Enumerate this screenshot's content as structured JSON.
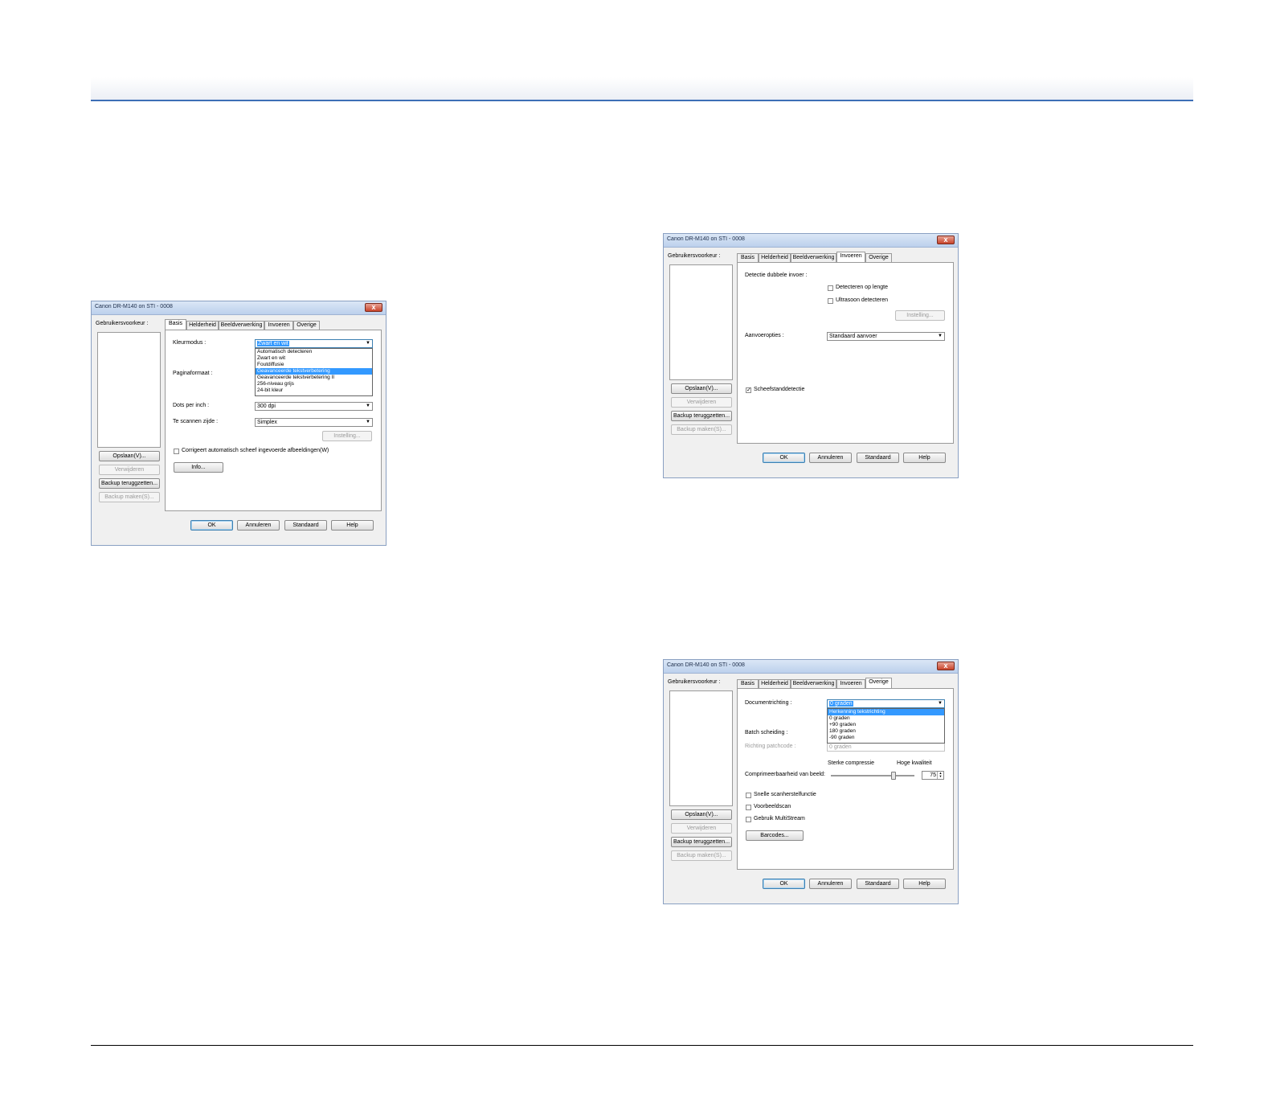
{
  "dialog_basis": {
    "title": "Canon DR-M140 on STI - 0008",
    "close": "x",
    "user_prefs_label": "Gebruikersvoorkeur :",
    "tabs": [
      "Basis",
      "Helderheid",
      "Beeldverwerking",
      "Invoeren",
      "Overige"
    ],
    "active_tab": "Basis",
    "color_mode_label": "Kleurmodus :",
    "color_mode_value": "Zwart en wit",
    "color_mode_options": [
      "Automatisch detecteren",
      "Zwart en wit",
      "Foutdiffusie",
      "Geavanceerde tekstverbetering",
      "Geavanceerde tekstverbetering II",
      "256-niveau grijs",
      "24-bit kleur"
    ],
    "color_mode_highlighted": "Geavanceerde tekstverbetering",
    "page_size_label": "Paginaformaat :",
    "dpi_label": "Dots per inch :",
    "dpi_value": "300 dpi",
    "side_label": "Te scannen zijde :",
    "side_value": "Simplex",
    "settings_button": "Instelling...",
    "deskew_label": "Corrigeert automatisch scheef ingevoerde afbeeldingen(W)",
    "info_button": "Info...",
    "save_button": "Opslaan(V)...",
    "delete_button": "Verwijderen",
    "restore_button": "Backup teruggzetten...",
    "backup_button": "Backup maken(S)...",
    "ok": "OK",
    "cancel": "Annuleren",
    "default": "Standaard",
    "help": "Help"
  },
  "dialog_invoeren": {
    "title": "Canon DR-M140 on STI - 0008",
    "close": "x",
    "user_prefs_label": "Gebruikersvoorkeur :",
    "tabs": [
      "Basis",
      "Helderheid",
      "Beeldverwerking",
      "Invoeren",
      "Overige"
    ],
    "active_tab": "Invoeren",
    "double_feed_label": "Detectie dubbele invoer :",
    "detect_length_label": "Detecteren op lengte",
    "ultrasonic_label": "Ultrasoon detecteren",
    "settings_button": "Instelling...",
    "feed_options_label": "Aanvoeropties :",
    "feed_options_value": "Standaard aanvoer",
    "skew_detect_label": "Scheefstanddetectie",
    "skew_detect_checked": true,
    "save_button": "Opslaan(V)...",
    "delete_button": "Verwijderen",
    "restore_button": "Backup teruggzetten...",
    "backup_button": "Backup maken(S)...",
    "ok": "OK",
    "cancel": "Annuleren",
    "default": "Standaard",
    "help": "Help"
  },
  "dialog_overige": {
    "title": "Canon DR-M140 on STI - 0008",
    "close": "x",
    "user_prefs_label": "Gebruikersvoorkeur :",
    "tabs": [
      "Basis",
      "Helderheid",
      "Beeldverwerking",
      "Invoeren",
      "Overige"
    ],
    "active_tab": "Overige",
    "doc_orientation_label": "Documentrichting :",
    "doc_orientation_value": "0 graden",
    "doc_orientation_options": [
      "Herkenning tekstrichting",
      "0 graden",
      "+90 graden",
      "180 graden",
      "-90 graden"
    ],
    "doc_orientation_highlighted": "Herkenning tekstrichting",
    "batch_label": "Batch scheiding :",
    "patch_label": "Richting patchcode :",
    "patch_value": "0 graden",
    "compress_low_label": "Sterke compressie",
    "compress_high_label": "Hoge kwaliteit",
    "compress_label": "Comprimeerbaarheid van beeld:",
    "compress_value": "75",
    "compress_level": 0.75,
    "quick_recovery_label": "Snelle scanherstelfunctie",
    "prescan_label": "Voorbeeldscan",
    "multistream_label": "Gebruik MultiStream",
    "barcodes_button": "Barcodes...",
    "save_button": "Opslaan(V)...",
    "delete_button": "Verwijderen",
    "restore_button": "Backup teruggzetten...",
    "backup_button": "Backup maken(S)...",
    "ok": "OK",
    "cancel": "Annuleren",
    "default": "Standaard",
    "help": "Help"
  }
}
